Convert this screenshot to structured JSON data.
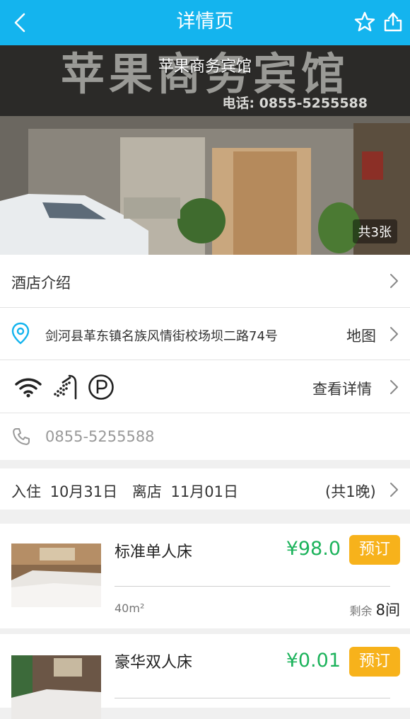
{
  "header": {
    "title": "详情页",
    "icons": [
      "back-icon",
      "star-icon",
      "share-icon"
    ]
  },
  "hero": {
    "hotel_name": "苹果商务宾馆",
    "sign_text": "苹果商务宾馆",
    "sign_phone": "电话: 0855-5255588",
    "photo_count": "共3张"
  },
  "intro": {
    "label": "酒店介绍"
  },
  "address": {
    "text": "剑河县革东镇名族风情街校场坝二路74号",
    "map_label": "地图"
  },
  "facilities": {
    "icons": [
      "wifi-icon",
      "shower-icon",
      "parking-icon"
    ],
    "detail_label": "查看详情"
  },
  "phone": {
    "number": "0855-5255588"
  },
  "stay": {
    "checkin_label": "入住",
    "checkin_date": "10月31日",
    "checkout_label": "离店",
    "checkout_date": "11月01日",
    "nights": "(共1晚)"
  },
  "rooms": [
    {
      "name": "标准单人床",
      "price": "¥98.0",
      "book_label": "预订",
      "area": "40m²",
      "remain_label": "剩余",
      "remain_count": "8间"
    },
    {
      "name": "豪华双人床",
      "price": "¥0.01",
      "book_label": "预订"
    }
  ],
  "colors": {
    "header": "#14b4ee",
    "price": "#1db35c",
    "book_button": "#f7b21b"
  }
}
